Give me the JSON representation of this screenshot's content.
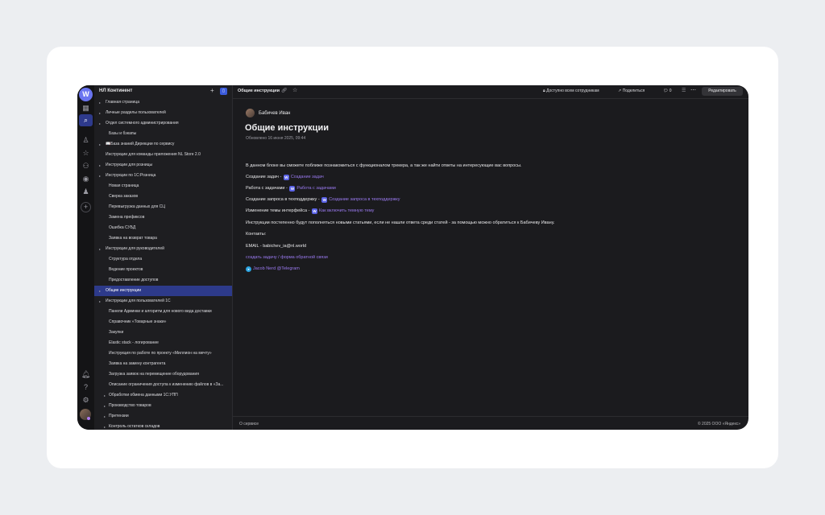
{
  "window": {
    "brand_letter": "W"
  },
  "rail": {
    "icons": [
      "grid-icon",
      "search-icon",
      "user-icon",
      "star-icon",
      "people-icon",
      "eye-icon",
      "person-icon",
      "add-icon",
      "bell-icon",
      "help-icon",
      "gear-icon"
    ]
  },
  "sidebar": {
    "title": "НЛ Континент",
    "plus": "+",
    "items": [
      {
        "label": "Главная страница",
        "level": 0,
        "arrow": true
      },
      {
        "label": "Личные разделы пользователей",
        "level": 0,
        "arrow": true
      },
      {
        "label": "Отдел системного администрирования",
        "level": 0,
        "arrow": true
      },
      {
        "label": "Базы и бэкапы",
        "level": 1,
        "arrow": false
      },
      {
        "label": "📖База знаний Дирекции по сервису",
        "level": 0,
        "arrow": true
      },
      {
        "label": "Инструкции для команды приложения NL Store 2.0",
        "level": 0,
        "arrow": false
      },
      {
        "label": "Инструкции для розницы",
        "level": 0,
        "arrow": true
      },
      {
        "label": "Инструкции по 1С:Розница",
        "level": 0,
        "arrow": true
      },
      {
        "label": "Новая страница",
        "level": 1,
        "arrow": false
      },
      {
        "label": "Сверка заказов",
        "level": 1,
        "arrow": false
      },
      {
        "label": "Перевыгрузка данных для СЦ",
        "level": 1,
        "arrow": false
      },
      {
        "label": "Замена префиксов",
        "level": 1,
        "arrow": false
      },
      {
        "label": "Ошибка СУБД",
        "level": 1,
        "arrow": false
      },
      {
        "label": "Заявка на возврат товара",
        "level": 1,
        "arrow": false
      },
      {
        "label": "Инструкции для руководителей",
        "level": 0,
        "arrow": true
      },
      {
        "label": "Структура отдела",
        "level": 1,
        "arrow": false
      },
      {
        "label": "Ведение проектов",
        "level": 1,
        "arrow": false
      },
      {
        "label": "Предоставление доступов",
        "level": 1,
        "arrow": false
      },
      {
        "label": "Общие инструкции",
        "level": 0,
        "arrow": true,
        "active": true
      },
      {
        "label": "Инструкции для пользователей 1С",
        "level": 0,
        "arrow": true
      },
      {
        "label": "Панели Админки и алгоритм для нового вида доставки",
        "level": 1,
        "arrow": false
      },
      {
        "label": "Справочник «Товарные знаки»",
        "level": 1,
        "arrow": false
      },
      {
        "label": "Закупки",
        "level": 1,
        "arrow": false
      },
      {
        "label": "Elastic stack - логирование",
        "level": 1,
        "arrow": false
      },
      {
        "label": "Инструкция по работе по проекту «Миллион на мечту»",
        "level": 1,
        "arrow": false
      },
      {
        "label": "Заявка на замену контрагента",
        "level": 1,
        "arrow": false
      },
      {
        "label": "Загрузка заявок на перемещение оборудования",
        "level": 1,
        "arrow": false
      },
      {
        "label": "Описание ограничения доступа к изменению файлов в «За...",
        "level": 1,
        "arrow": false
      },
      {
        "label": "Обработки обмена данными 1С:УПП",
        "level": 1,
        "arrow": true
      },
      {
        "label": "Производство товаров",
        "level": 1,
        "arrow": true
      },
      {
        "label": "Претензии",
        "level": 1,
        "arrow": true
      },
      {
        "label": "Контроль остатков складов",
        "level": 1,
        "arrow": true
      }
    ]
  },
  "topbar": {
    "doc_title": "Общие инструкции",
    "access": "Доступно всем сотрудникам",
    "share": "Поделиться",
    "comments_count": "0",
    "edit": "Редактировать"
  },
  "page": {
    "author": "Бабичев Иван",
    "title": "Общие инструкции",
    "updated": "Обновлено 16 июня 2025, 09:44",
    "intro": "В данном блоке вы сможете поближе познакомиться с функционалом трекера, а так же найти ответы на интересующие вас вопросы.",
    "rows": [
      {
        "label": "Создание задач - ",
        "link": "Создание задач"
      },
      {
        "label": "Работа с задачами - ",
        "link": "Работа с задачами"
      },
      {
        "label": "Создание запроса в техподдержку - ",
        "link": "Создание запроса в техподдержку"
      },
      {
        "label": "Изменение темы интерфейса - ",
        "link": "Как включить темную тему"
      }
    ],
    "note": "Инструкции постепенно будут пополняться новыми статьями, если не нашли ответа среди статей - за помощью можно обратиться к Бабичеву Ивану.",
    "contacts": "Контакты:",
    "email": "EMAIL - babichev_ia@nl.world",
    "feedback": "создать задачу / форма обратной связи",
    "telegram": "Jacob Nerd @Telegram"
  },
  "footer": {
    "left": "О сервисе",
    "right": "© 2025 ООО «Яндекс»"
  },
  "colors": {
    "accent": "#5b63e6",
    "link": "#9a7af0",
    "active_item": "#2d3a8a"
  }
}
